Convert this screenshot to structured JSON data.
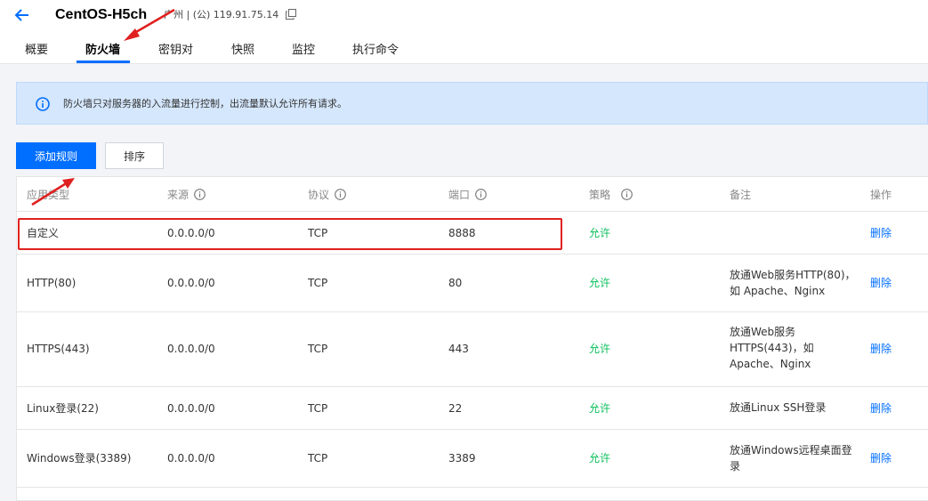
{
  "header": {
    "instance_name": "CentOS-H5ch",
    "instance_meta": "广州 | (公) 119.91.75.14"
  },
  "tabs": [
    "概要",
    "防火墙",
    "密钥对",
    "快照",
    "监控",
    "执行命令"
  ],
  "active_tab": "防火墙",
  "notice": "防火墙只对服务器的入流量进行控制，出流量默认允许所有请求。",
  "toolbar": {
    "add_rule": "添加规则",
    "sort": "排序"
  },
  "table": {
    "headers": {
      "app_type": "应用类型",
      "source": "来源",
      "protocol": "协议",
      "port": "端口",
      "policy": "策略",
      "note": "备注",
      "action": "操作"
    },
    "rows": [
      {
        "app_type": "自定义",
        "source": "0.0.0.0/0",
        "protocol": "TCP",
        "port": "8888",
        "policy": "允许",
        "note": "",
        "action": "删除"
      },
      {
        "app_type": "HTTP(80)",
        "source": "0.0.0.0/0",
        "protocol": "TCP",
        "port": "80",
        "policy": "允许",
        "note": "放通Web服务HTTP(80)，如 Apache、Nginx",
        "action": "删除"
      },
      {
        "app_type": "HTTPS(443)",
        "source": "0.0.0.0/0",
        "protocol": "TCP",
        "port": "443",
        "policy": "允许",
        "note": "放通Web服务HTTPS(443)，如Apache、Nginx",
        "action": "删除"
      },
      {
        "app_type": "Linux登录(22)",
        "source": "0.0.0.0/0",
        "protocol": "TCP",
        "port": "22",
        "policy": "允许",
        "note": "放通Linux SSH登录",
        "action": "删除"
      },
      {
        "app_type": "Windows登录(3389)",
        "source": "0.0.0.0/0",
        "protocol": "TCP",
        "port": "3389",
        "policy": "允许",
        "note": "放通Windows远程桌面登录",
        "action": "删除"
      }
    ]
  },
  "colors": {
    "accent": "#006eff",
    "allow": "#0abf5b",
    "annotation": "#e02020",
    "notice_bg": "#d5e7fd"
  },
  "icons": [
    "back-arrow-icon",
    "copy-icon",
    "info-icon",
    "annotation-arrow"
  ]
}
